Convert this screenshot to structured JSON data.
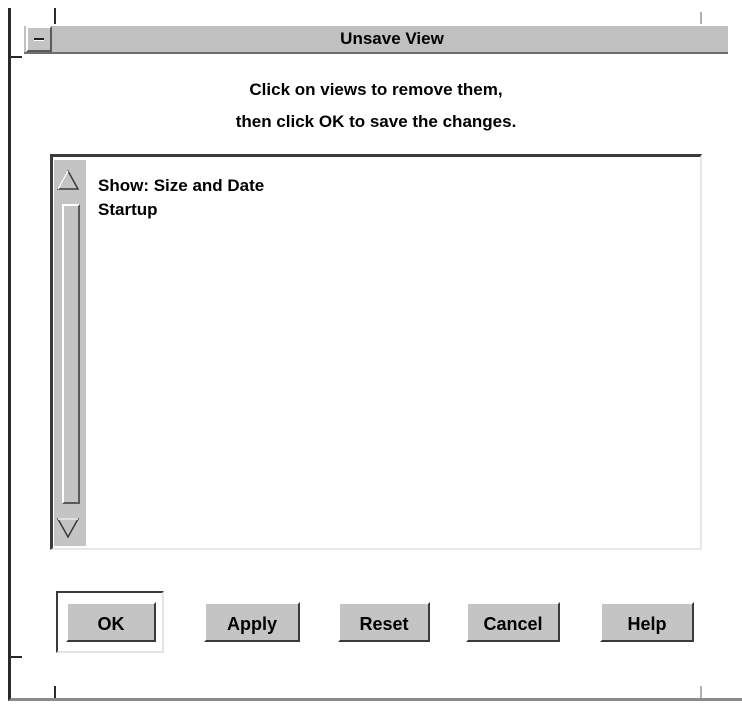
{
  "window": {
    "title": "Unsave View",
    "menu_icon": "window-menu-icon"
  },
  "instructions": {
    "line1": "Click on views to remove them,",
    "line2": "then click OK to save the changes."
  },
  "list": {
    "items": [
      "Show: Size and Date",
      "Startup"
    ]
  },
  "buttons": {
    "ok": "OK",
    "apply": "Apply",
    "reset": "Reset",
    "cancel": "Cancel",
    "help": "Help"
  },
  "colors": {
    "panel": "#c4c4c4",
    "background": "#ffffff",
    "shadow": "#3a3a3a"
  }
}
